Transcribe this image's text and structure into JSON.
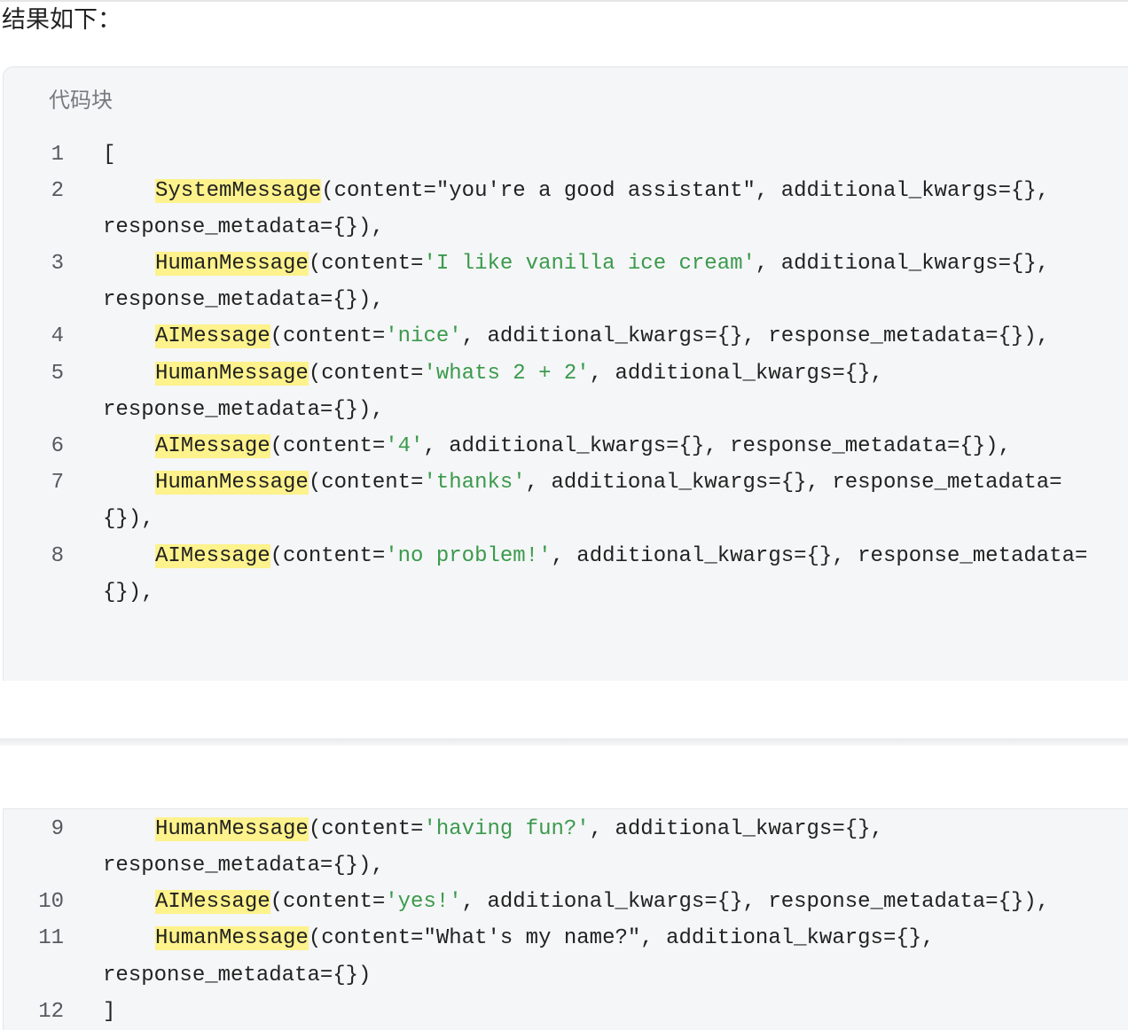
{
  "intro_text": "结果如下：",
  "code_block": {
    "label": "代码块",
    "open_bracket": "[",
    "close_bracket": "]",
    "lines": [
      {
        "number": "1"
      },
      {
        "number": "2",
        "cls": "SystemMessage",
        "pre": "(content=",
        "str": "\"you're a good assistant\"",
        "post": ", additional_kwargs={},",
        "cont": "response_metadata={}),"
      },
      {
        "number": "3",
        "cls": "HumanMessage",
        "pre": "(content=",
        "str": "'I like vanilla ice cream'",
        "post": ", additional_kwargs={},",
        "cont": "response_metadata={}),"
      },
      {
        "number": "4",
        "cls": "AIMessage",
        "pre": "(content=",
        "str": "'nice'",
        "post": ", additional_kwargs={}, response_metadata={}),"
      },
      {
        "number": "5",
        "cls": "HumanMessage",
        "pre": "(content=",
        "str": "'whats 2 + 2'",
        "post": ", additional_kwargs={},",
        "cont": "response_metadata={}),"
      },
      {
        "number": "6",
        "cls": "AIMessage",
        "pre": "(content=",
        "str": "'4'",
        "post": ", additional_kwargs={}, response_metadata={}),"
      },
      {
        "number": "7",
        "cls": "HumanMessage",
        "pre": "(content=",
        "str": "'thanks'",
        "post": ", additional_kwargs={}, response_metadata=",
        "cont": "{}),"
      },
      {
        "number": "8",
        "cls": "AIMessage",
        "pre": "(content=",
        "str": "'no problem!'",
        "post": ", additional_kwargs={}, response_metadata=",
        "cont": "{}),"
      },
      {
        "number": "9",
        "cls": "HumanMessage",
        "pre": "(content=",
        "str": "'having fun?'",
        "post": ", additional_kwargs={},",
        "cont": "response_metadata={}),"
      },
      {
        "number": "10",
        "cls": "AIMessage",
        "pre": "(content=",
        "str": "'yes!'",
        "post": ", additional_kwargs={}, response_metadata={}),"
      },
      {
        "number": "11",
        "cls": "HumanMessage",
        "pre": "(content=",
        "str": "\"What's my name?\"",
        "post": ", additional_kwargs={},",
        "cont": "response_metadata={})"
      },
      {
        "number": "12"
      }
    ]
  },
  "colors": {
    "class_highlight": "#fdf28c",
    "single_quote_string": "#3a9a4c",
    "code_background": "#f5f6f7"
  }
}
